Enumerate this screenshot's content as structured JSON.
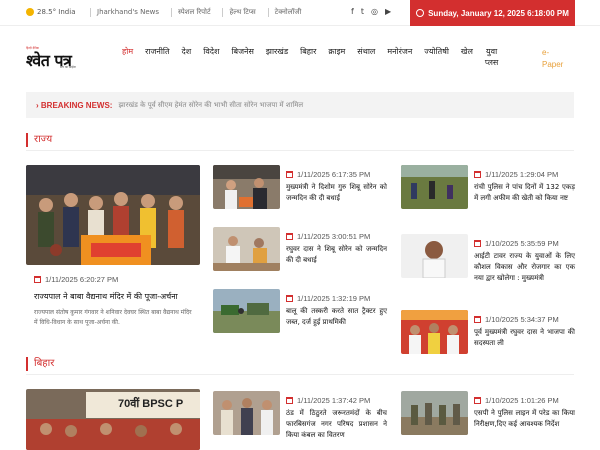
{
  "topbar": {
    "weather": "28.5° India",
    "links": [
      "Jharkhand's News",
      "स्पेशल रिपोर्ट",
      "हेल्थ टिप्स",
      "टेक्नोलॉजी"
    ],
    "social": [
      "f",
      "t",
      "◎",
      "▶"
    ],
    "date": "Sunday, January 12, 2025 6:18:00 PM",
    "accent": "#d32f2f"
  },
  "logo": {
    "top": "हिन्दी दैनिक",
    "main": "श्वेत पत्र",
    "tag": "सच का आईना"
  },
  "nav": {
    "items": [
      "होम",
      "राजनीति",
      "देश",
      "विदेश",
      "बिजनेस",
      "झारखंड",
      "बिहार",
      "क्राइम",
      "संथाल",
      "मनोरंजन",
      "ज्योतिषी",
      "खेल"
    ],
    "yuva1": "युवा",
    "yuva2": "प्लस",
    "epaper1": "e-",
    "epaper2": "Paper"
  },
  "breaking": {
    "label": "BREAKING NEWS:",
    "text": "झारखंड के पूर्व सीएम हेमंत सोरेन की भाभी सीता सोरेन भाजपा में शामिल"
  },
  "sections": {
    "rajya": "राज्य",
    "bihar": "बिहार"
  },
  "feature": {
    "date": "1/11/2025 6:20:27 PM",
    "title": "राज्यपाल ने बाबा वैद्यनाथ मंदिर में की पूजा-अर्चना",
    "desc": "राज्यपाल संतोष कुमार गंगवार ने शनिवार देवघर स्थित बाबा वैद्यनाथ मंदिर में विधि-विधान के साथ पूजा-अर्चना की."
  },
  "bihar_feature": {
    "banner": "70वीं BPSC P"
  },
  "col2": [
    {
      "date": "1/11/2025 6:17:35 PM",
      "title": "मुख्यमंत्री ने दिशोम गुरु शिबू सोरेन को जन्मदिन की दी बधाई"
    },
    {
      "date": "1/11/2025 3:00:51 PM",
      "title": "रघुवर दास ने शिबू सोरेन को जन्मदिन की दी बधाई"
    },
    {
      "date": "1/11/2025 1:32:19 PM",
      "title": "बालू की तस्करी करते सात ट्रैक्टर हुए जब्त, दर्ज हुई प्राथमिकी"
    },
    {
      "date": "1/11/2025 1:37:42 PM",
      "title": "ठंड में ठिठुरते जरूरतमंदों के बीच फारबिसगंज नगर परिषद प्रशासन ने किया कंबल का वितरण"
    }
  ],
  "col3": [
    {
      "date": "1/11/2025 1:29:04 PM",
      "title": "रांची पुलिस ने पांच दिनों में 132 एकड़ में लगी अफीम की खेती को किया नष्ट"
    },
    {
      "date": "1/10/2025 5:35:59 PM",
      "title": "आईटी टावर राज्य के युवाओं के लिए कौशल विकास और रोजगार का एक नया द्वार खोलेगा : मुख्यमंत्री"
    },
    {
      "date": "1/10/2025 5:34:37 PM",
      "title": "पूर्व मुख्यमंत्री रघुवर दास ने भाजपा की सदस्यता ली"
    },
    {
      "date": "1/10/2025 1:01:26 PM",
      "title": "एसपी ने पुलिस लाइन में परेड का किया निरीक्षण,दिए कई आवश्यक निर्देश"
    }
  ]
}
